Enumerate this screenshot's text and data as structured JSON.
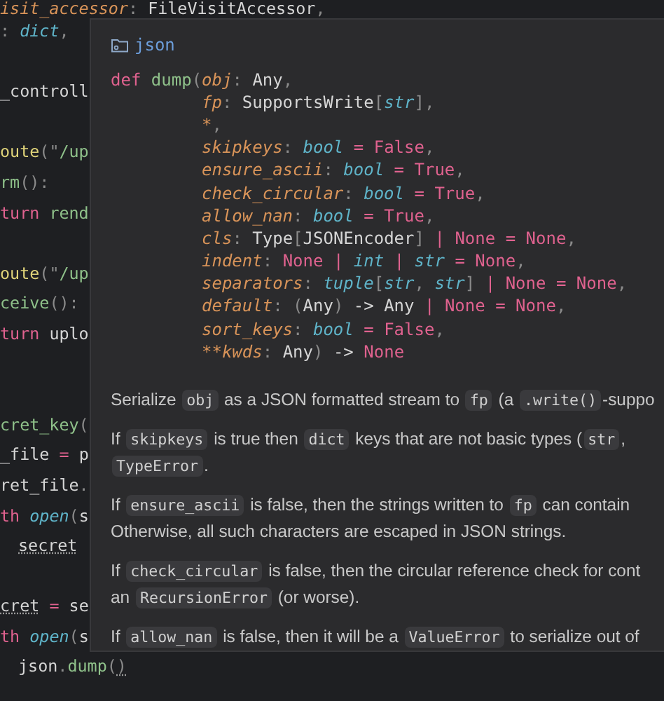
{
  "editor": {
    "lines": [
      {
        "kind": "code",
        "tokens": [
          {
            "kind": "param",
            "text": "isit_accessor"
          },
          {
            "kind": "punct",
            "text": ": "
          },
          {
            "kind": "plain",
            "text": "FileVisitAccessor"
          },
          {
            "kind": "punct",
            "text": ","
          }
        ]
      },
      {
        "kind": "code",
        "tokens": [
          {
            "kind": "punct",
            "text": ": "
          },
          {
            "kind": "type",
            "text": "dict"
          },
          {
            "kind": "punct",
            "text": ","
          }
        ]
      },
      {
        "kind": "blank"
      },
      {
        "kind": "code",
        "tokens": [
          {
            "kind": "plain",
            "text": "_controll"
          }
        ]
      },
      {
        "kind": "blank"
      },
      {
        "kind": "code",
        "tokens": [
          {
            "kind": "decorator",
            "text": "oute"
          },
          {
            "kind": "punct",
            "text": "(\""
          },
          {
            "kind": "string",
            "text": "/up"
          }
        ]
      },
      {
        "kind": "code",
        "tokens": [
          {
            "kind": "function",
            "text": "rm"
          },
          {
            "kind": "punct",
            "text": "():"
          }
        ]
      },
      {
        "kind": "code",
        "tokens": [
          {
            "kind": "keyword",
            "text": "turn "
          },
          {
            "kind": "function",
            "text": "rend"
          }
        ]
      },
      {
        "kind": "blank"
      },
      {
        "kind": "code",
        "tokens": [
          {
            "kind": "decorator",
            "text": "oute"
          },
          {
            "kind": "punct",
            "text": "(\""
          },
          {
            "kind": "string",
            "text": "/up"
          }
        ]
      },
      {
        "kind": "code",
        "tokens": [
          {
            "kind": "function",
            "text": "ceive"
          },
          {
            "kind": "punct",
            "text": "():"
          }
        ]
      },
      {
        "kind": "code",
        "tokens": [
          {
            "kind": "keyword",
            "text": "turn "
          },
          {
            "kind": "plain",
            "text": "uplo"
          }
        ]
      },
      {
        "kind": "blank"
      },
      {
        "kind": "blank"
      },
      {
        "kind": "code",
        "tokens": [
          {
            "kind": "function",
            "text": "cret_key"
          },
          {
            "kind": "punct",
            "text": "("
          }
        ]
      },
      {
        "kind": "code",
        "tokens": [
          {
            "kind": "plain",
            "text": "_file "
          },
          {
            "kind": "operator",
            "text": "= "
          },
          {
            "kind": "plain",
            "text": "p"
          }
        ]
      },
      {
        "kind": "code",
        "tokens": [
          {
            "kind": "plain",
            "text": "ret_file"
          },
          {
            "kind": "punct",
            "text": "."
          }
        ]
      },
      {
        "kind": "code",
        "tokens": [
          {
            "kind": "keyword",
            "text": "th "
          },
          {
            "kind": "type",
            "text": "open"
          },
          {
            "kind": "punct",
            "text": "("
          },
          {
            "kind": "plain",
            "text": "s"
          }
        ]
      },
      {
        "kind": "indented",
        "tokens": [
          {
            "kind": "plain",
            "text": "secret",
            "underlined": true
          }
        ]
      },
      {
        "kind": "blank"
      },
      {
        "kind": "code",
        "tokens": [
          {
            "kind": "plain",
            "text": "cret",
            "underlined": true
          },
          {
            "kind": "operator",
            "text": " = "
          },
          {
            "kind": "plain",
            "text": "se"
          }
        ]
      },
      {
        "kind": "code",
        "tokens": [
          {
            "kind": "keyword",
            "text": "th "
          },
          {
            "kind": "type",
            "text": "open"
          },
          {
            "kind": "punct",
            "text": "("
          },
          {
            "kind": "plain",
            "text": "s"
          }
        ]
      },
      {
        "kind": "indented",
        "tokens": [
          {
            "kind": "plain",
            "text": "json"
          },
          {
            "kind": "punct",
            "text": "."
          },
          {
            "kind": "function",
            "text": "dump"
          },
          {
            "kind": "punct",
            "text": "("
          },
          {
            "kind": "punct",
            "text": ")",
            "underlined": true
          }
        ]
      }
    ]
  },
  "hover": {
    "module": "json",
    "signature": {
      "first_line": [
        {
          "kind": "keyword",
          "text": "def "
        },
        {
          "kind": "function",
          "text": "dump"
        },
        {
          "kind": "punct",
          "text": "("
        },
        {
          "kind": "param",
          "text": "obj"
        },
        {
          "kind": "punct",
          "text": ": "
        },
        {
          "kind": "plain",
          "text": "Any"
        },
        {
          "kind": "punct",
          "text": ","
        }
      ],
      "continuation_lines": [
        [
          {
            "kind": "param",
            "text": "fp"
          },
          {
            "kind": "punct",
            "text": ": "
          },
          {
            "kind": "plain",
            "text": "SupportsWrite"
          },
          {
            "kind": "punct",
            "text": "["
          },
          {
            "kind": "type",
            "text": "str"
          },
          {
            "kind": "punct",
            "text": "],"
          }
        ],
        [
          {
            "kind": "param",
            "text": "*"
          },
          {
            "kind": "punct",
            "text": ","
          }
        ],
        [
          {
            "kind": "param",
            "text": "skipkeys"
          },
          {
            "kind": "punct",
            "text": ": "
          },
          {
            "kind": "type",
            "text": "bool"
          },
          {
            "kind": "operator",
            "text": " = "
          },
          {
            "kind": "constant",
            "text": "False"
          },
          {
            "kind": "punct",
            "text": ","
          }
        ],
        [
          {
            "kind": "param",
            "text": "ensure_ascii"
          },
          {
            "kind": "punct",
            "text": ": "
          },
          {
            "kind": "type",
            "text": "bool"
          },
          {
            "kind": "operator",
            "text": " = "
          },
          {
            "kind": "constant",
            "text": "True"
          },
          {
            "kind": "punct",
            "text": ","
          }
        ],
        [
          {
            "kind": "param",
            "text": "check_circular"
          },
          {
            "kind": "punct",
            "text": ": "
          },
          {
            "kind": "type",
            "text": "bool"
          },
          {
            "kind": "operator",
            "text": " = "
          },
          {
            "kind": "constant",
            "text": "True"
          },
          {
            "kind": "punct",
            "text": ","
          }
        ],
        [
          {
            "kind": "param",
            "text": "allow_nan"
          },
          {
            "kind": "punct",
            "text": ": "
          },
          {
            "kind": "type",
            "text": "bool"
          },
          {
            "kind": "operator",
            "text": " = "
          },
          {
            "kind": "constant",
            "text": "True"
          },
          {
            "kind": "punct",
            "text": ","
          }
        ],
        [
          {
            "kind": "param",
            "text": "cls"
          },
          {
            "kind": "punct",
            "text": ": "
          },
          {
            "kind": "plain",
            "text": "Type"
          },
          {
            "kind": "punct",
            "text": "["
          },
          {
            "kind": "plain",
            "text": "JSONEncoder"
          },
          {
            "kind": "punct",
            "text": "]"
          },
          {
            "kind": "operator",
            "text": " | "
          },
          {
            "kind": "constant",
            "text": "None"
          },
          {
            "kind": "operator",
            "text": " = "
          },
          {
            "kind": "constant",
            "text": "None"
          },
          {
            "kind": "punct",
            "text": ","
          }
        ],
        [
          {
            "kind": "param",
            "text": "indent"
          },
          {
            "kind": "punct",
            "text": ": "
          },
          {
            "kind": "constant",
            "text": "None"
          },
          {
            "kind": "operator",
            "text": " | "
          },
          {
            "kind": "type",
            "text": "int"
          },
          {
            "kind": "operator",
            "text": " | "
          },
          {
            "kind": "type",
            "text": "str"
          },
          {
            "kind": "operator",
            "text": " = "
          },
          {
            "kind": "constant",
            "text": "None"
          },
          {
            "kind": "punct",
            "text": ","
          }
        ],
        [
          {
            "kind": "param",
            "text": "separators"
          },
          {
            "kind": "punct",
            "text": ": "
          },
          {
            "kind": "type",
            "text": "tuple"
          },
          {
            "kind": "punct",
            "text": "["
          },
          {
            "kind": "type",
            "text": "str"
          },
          {
            "kind": "punct",
            "text": ", "
          },
          {
            "kind": "type",
            "text": "str"
          },
          {
            "kind": "punct",
            "text": "]"
          },
          {
            "kind": "operator",
            "text": " | "
          },
          {
            "kind": "constant",
            "text": "None"
          },
          {
            "kind": "operator",
            "text": " = "
          },
          {
            "kind": "constant",
            "text": "None"
          },
          {
            "kind": "punct",
            "text": ","
          }
        ],
        [
          {
            "kind": "param",
            "text": "default"
          },
          {
            "kind": "punct",
            "text": ": ("
          },
          {
            "kind": "plain",
            "text": "Any"
          },
          {
            "kind": "punct",
            "text": ")"
          },
          {
            "kind": "plain",
            "text": " -> Any"
          },
          {
            "kind": "operator",
            "text": " | "
          },
          {
            "kind": "constant",
            "text": "None"
          },
          {
            "kind": "operator",
            "text": " = "
          },
          {
            "kind": "constant",
            "text": "None"
          },
          {
            "kind": "punct",
            "text": ","
          }
        ],
        [
          {
            "kind": "param",
            "text": "sort_keys"
          },
          {
            "kind": "punct",
            "text": ": "
          },
          {
            "kind": "type",
            "text": "bool"
          },
          {
            "kind": "operator",
            "text": " = "
          },
          {
            "kind": "constant",
            "text": "False"
          },
          {
            "kind": "punct",
            "text": ","
          }
        ],
        [
          {
            "kind": "param",
            "text": "**kwds"
          },
          {
            "kind": "punct",
            "text": ": "
          },
          {
            "kind": "plain",
            "text": "Any"
          },
          {
            "kind": "punct",
            "text": ")"
          },
          {
            "kind": "plain",
            "text": " -> "
          },
          {
            "kind": "constant",
            "text": "None"
          }
        ]
      ]
    },
    "paragraphs": [
      [
        [
          {
            "kind": "text",
            "text": "Serialize "
          },
          {
            "kind": "code",
            "text": "obj"
          },
          {
            "kind": "text",
            "text": " as a JSON formatted stream to "
          },
          {
            "kind": "code",
            "text": "fp"
          },
          {
            "kind": "text",
            "text": " (a "
          },
          {
            "kind": "code",
            "text": ".write()"
          },
          {
            "kind": "text",
            "text": "-suppo"
          }
        ]
      ],
      [
        [
          {
            "kind": "text",
            "text": "If "
          },
          {
            "kind": "code",
            "text": "skipkeys"
          },
          {
            "kind": "text",
            "text": " is true then "
          },
          {
            "kind": "code",
            "text": "dict"
          },
          {
            "kind": "text",
            "text": " keys that are not basic types ("
          },
          {
            "kind": "code",
            "text": "str"
          },
          {
            "kind": "text",
            "text": ","
          }
        ],
        [
          {
            "kind": "code",
            "text": "TypeError"
          },
          {
            "kind": "text",
            "text": "."
          }
        ]
      ],
      [
        [
          {
            "kind": "text",
            "text": "If "
          },
          {
            "kind": "code",
            "text": "ensure_ascii"
          },
          {
            "kind": "text",
            "text": " is false, then the strings written to "
          },
          {
            "kind": "code",
            "text": "fp"
          },
          {
            "kind": "text",
            "text": " can contain"
          }
        ],
        [
          {
            "kind": "text",
            "text": "Otherwise, all such characters are escaped in JSON strings."
          }
        ]
      ],
      [
        [
          {
            "kind": "text",
            "text": "If "
          },
          {
            "kind": "code",
            "text": "check_circular"
          },
          {
            "kind": "text",
            "text": " is false, then the circular reference check for cont"
          }
        ],
        [
          {
            "kind": "text",
            "text": "an "
          },
          {
            "kind": "code",
            "text": "RecursionError"
          },
          {
            "kind": "text",
            "text": " (or worse)."
          }
        ]
      ],
      [
        [
          {
            "kind": "text",
            "text": "If "
          },
          {
            "kind": "code",
            "text": "allow_nan"
          },
          {
            "kind": "text",
            "text": " is false, then it will be a "
          },
          {
            "kind": "code",
            "text": "ValueError"
          },
          {
            "kind": "text",
            "text": " to serialize out of"
          }
        ]
      ]
    ]
  }
}
